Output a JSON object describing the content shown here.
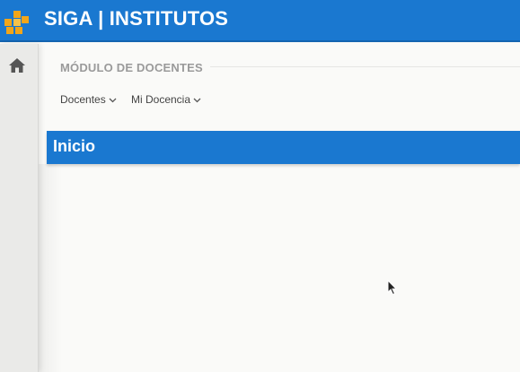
{
  "app": {
    "title": "SIGA | INSTITUTOS",
    "logo_icon": "siga-logo-icon"
  },
  "sidebar": {
    "home_icon": "home-icon"
  },
  "module": {
    "title": "MÓDULO DE DOCENTES"
  },
  "menu": {
    "items": [
      {
        "label": "Docentes"
      },
      {
        "label": "Mi Docencia"
      }
    ]
  },
  "page": {
    "title": "Inicio"
  },
  "colors": {
    "header_blue": "#1a78d0",
    "logo_orange": "#f2a61a"
  }
}
